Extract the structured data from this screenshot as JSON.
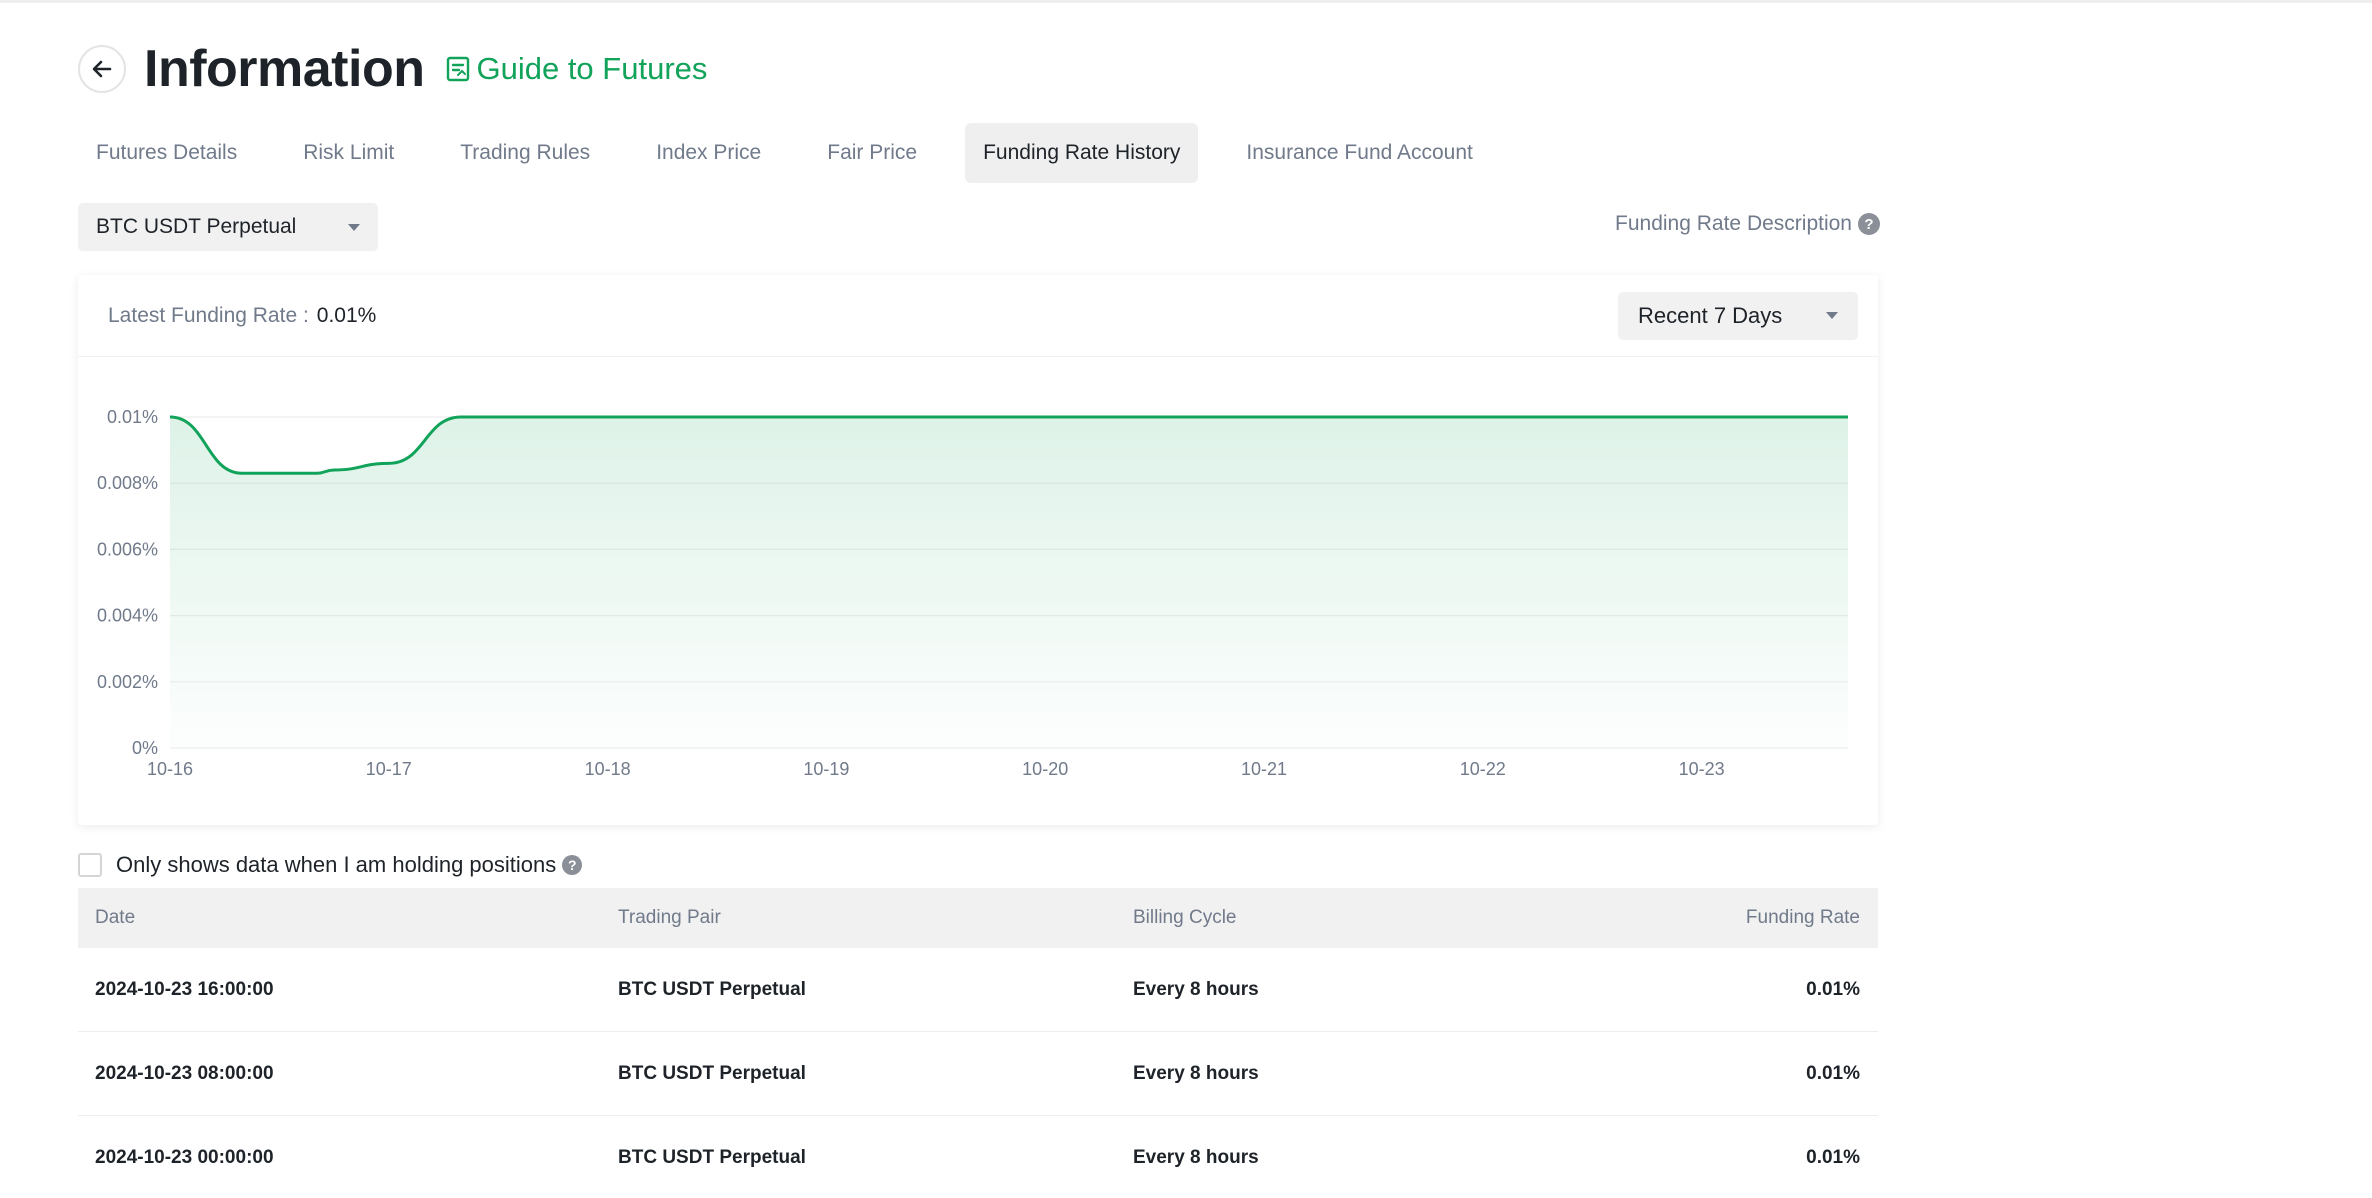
{
  "header": {
    "title": "Information",
    "guide_link": "Guide to Futures"
  },
  "tabs": [
    {
      "label": "Futures Details",
      "active": false
    },
    {
      "label": "Risk Limit",
      "active": false
    },
    {
      "label": "Trading Rules",
      "active": false
    },
    {
      "label": "Index Price",
      "active": false
    },
    {
      "label": "Fair Price",
      "active": false
    },
    {
      "label": "Funding Rate History",
      "active": true
    },
    {
      "label": "Insurance Fund Account",
      "active": false
    }
  ],
  "pair_select": {
    "value": "BTC USDT Perpetual"
  },
  "description_link": "Funding Rate Description",
  "chart_card": {
    "latest_label": "Latest Funding Rate :",
    "latest_value": "0.01%",
    "range_select": "Recent 7 Days"
  },
  "chart_data": {
    "type": "area",
    "title": "",
    "xlabel": "",
    "ylabel": "",
    "x_tick_labels": [
      "10-16",
      "10-17",
      "10-18",
      "10-19",
      "10-20",
      "10-21",
      "10-22",
      "10-23"
    ],
    "y_tick_labels": [
      "0%",
      "0.002%",
      "0.004%",
      "0.006%",
      "0.008%",
      "0.01%"
    ],
    "ylim": [
      0,
      0.01
    ],
    "y_unit": "%",
    "grid": true,
    "series": [
      {
        "color": "#12a35a",
        "x": [
          "10-16",
          "10-16",
          "10-16",
          "10-16",
          "10-17",
          "10-17",
          "10-17",
          "10-17",
          "10-18",
          "10-19",
          "10-20",
          "10-21",
          "10-22",
          "10-23",
          "10-23"
        ],
        "x_offset_days": [
          0,
          0.33,
          0.67,
          0.75,
          0,
          0.33,
          0.67,
          1,
          2,
          3,
          4,
          5,
          6,
          7,
          7.67
        ],
        "y": [
          0.01,
          0.0083,
          0.0083,
          0.0084,
          0.0086,
          0.01,
          0.01,
          0.01,
          0.01,
          0.01,
          0.01,
          0.01,
          0.01,
          0.01,
          0.01
        ]
      }
    ]
  },
  "holding_filter": {
    "label": "Only shows data when I am holding positions",
    "checked": false
  },
  "table": {
    "columns": [
      "Date",
      "Trading Pair",
      "Billing Cycle",
      "Funding Rate"
    ],
    "rows": [
      [
        "2024-10-23 16:00:00",
        "BTC USDT Perpetual",
        "Every 8 hours",
        "0.01%"
      ],
      [
        "2024-10-23 08:00:00",
        "BTC USDT Perpetual",
        "Every 8 hours",
        "0.01%"
      ],
      [
        "2024-10-23 00:00:00",
        "BTC USDT Perpetual",
        "Every 8 hours",
        "0.01%"
      ]
    ]
  },
  "colors": {
    "accent": "#12a35a",
    "text_primary": "#1e2329",
    "text_secondary": "#707a8a"
  }
}
